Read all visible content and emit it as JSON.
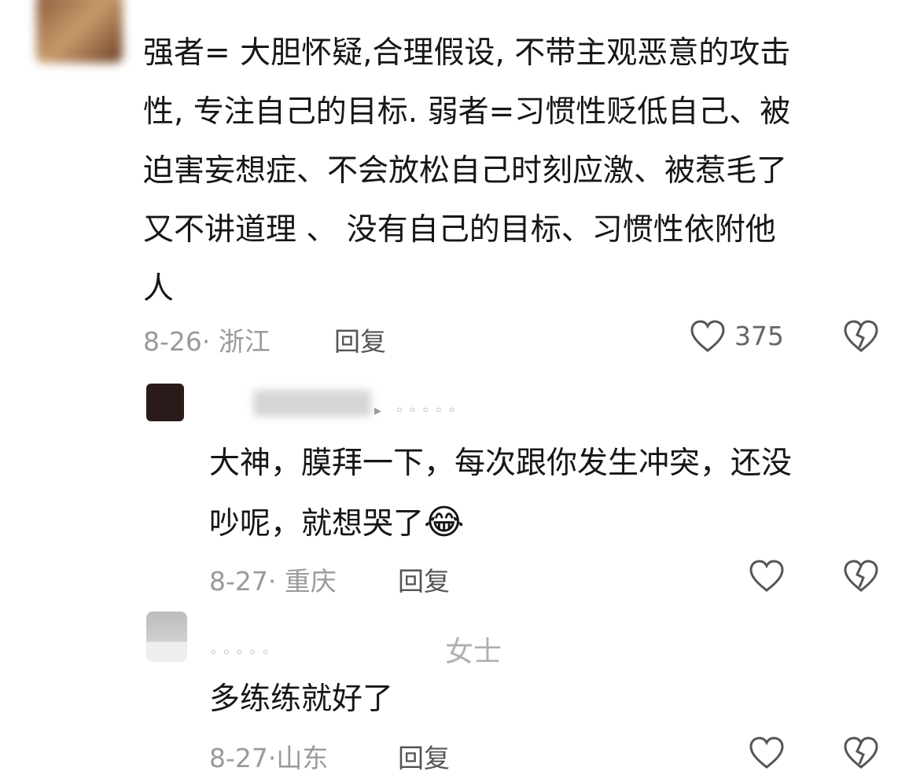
{
  "comments": [
    {
      "text_lines": [
        "强者= 大胆怀疑,合理假设, 不带主观恶意的攻击",
        "性, 专注自己的目标. 弱者=习惯性贬低自己、被",
        "迫害妄想症、不会放松自己时刻应激、被惹毛了",
        "又不讲道理 、 没有自己的目标、习惯性依附他",
        "人"
      ],
      "date_location": "8-26· 浙江",
      "reply_label": "回复",
      "like_count": "375"
    },
    {
      "username_suffix": "▸ ◦◦◦◦◦",
      "text_lines": [
        "大神，膜拜一下，每次跟你发生冲突，还没",
        "吵呢，就想哭了"
      ],
      "emoji": "😂",
      "date_location": "8-27· 重庆",
      "reply_label": "回复"
    },
    {
      "username_dots": "◦◦◦◦◦",
      "username_tag": "女士",
      "text_lines": [
        "多练练就好了"
      ],
      "date_location": "8-27·山东",
      "reply_label": "回复"
    }
  ],
  "colors": {
    "meta": "#9a9a9a",
    "text": "#161616",
    "icon": "#555555"
  },
  "icons": [
    "heart-outline-icon",
    "broken-heart-icon"
  ]
}
